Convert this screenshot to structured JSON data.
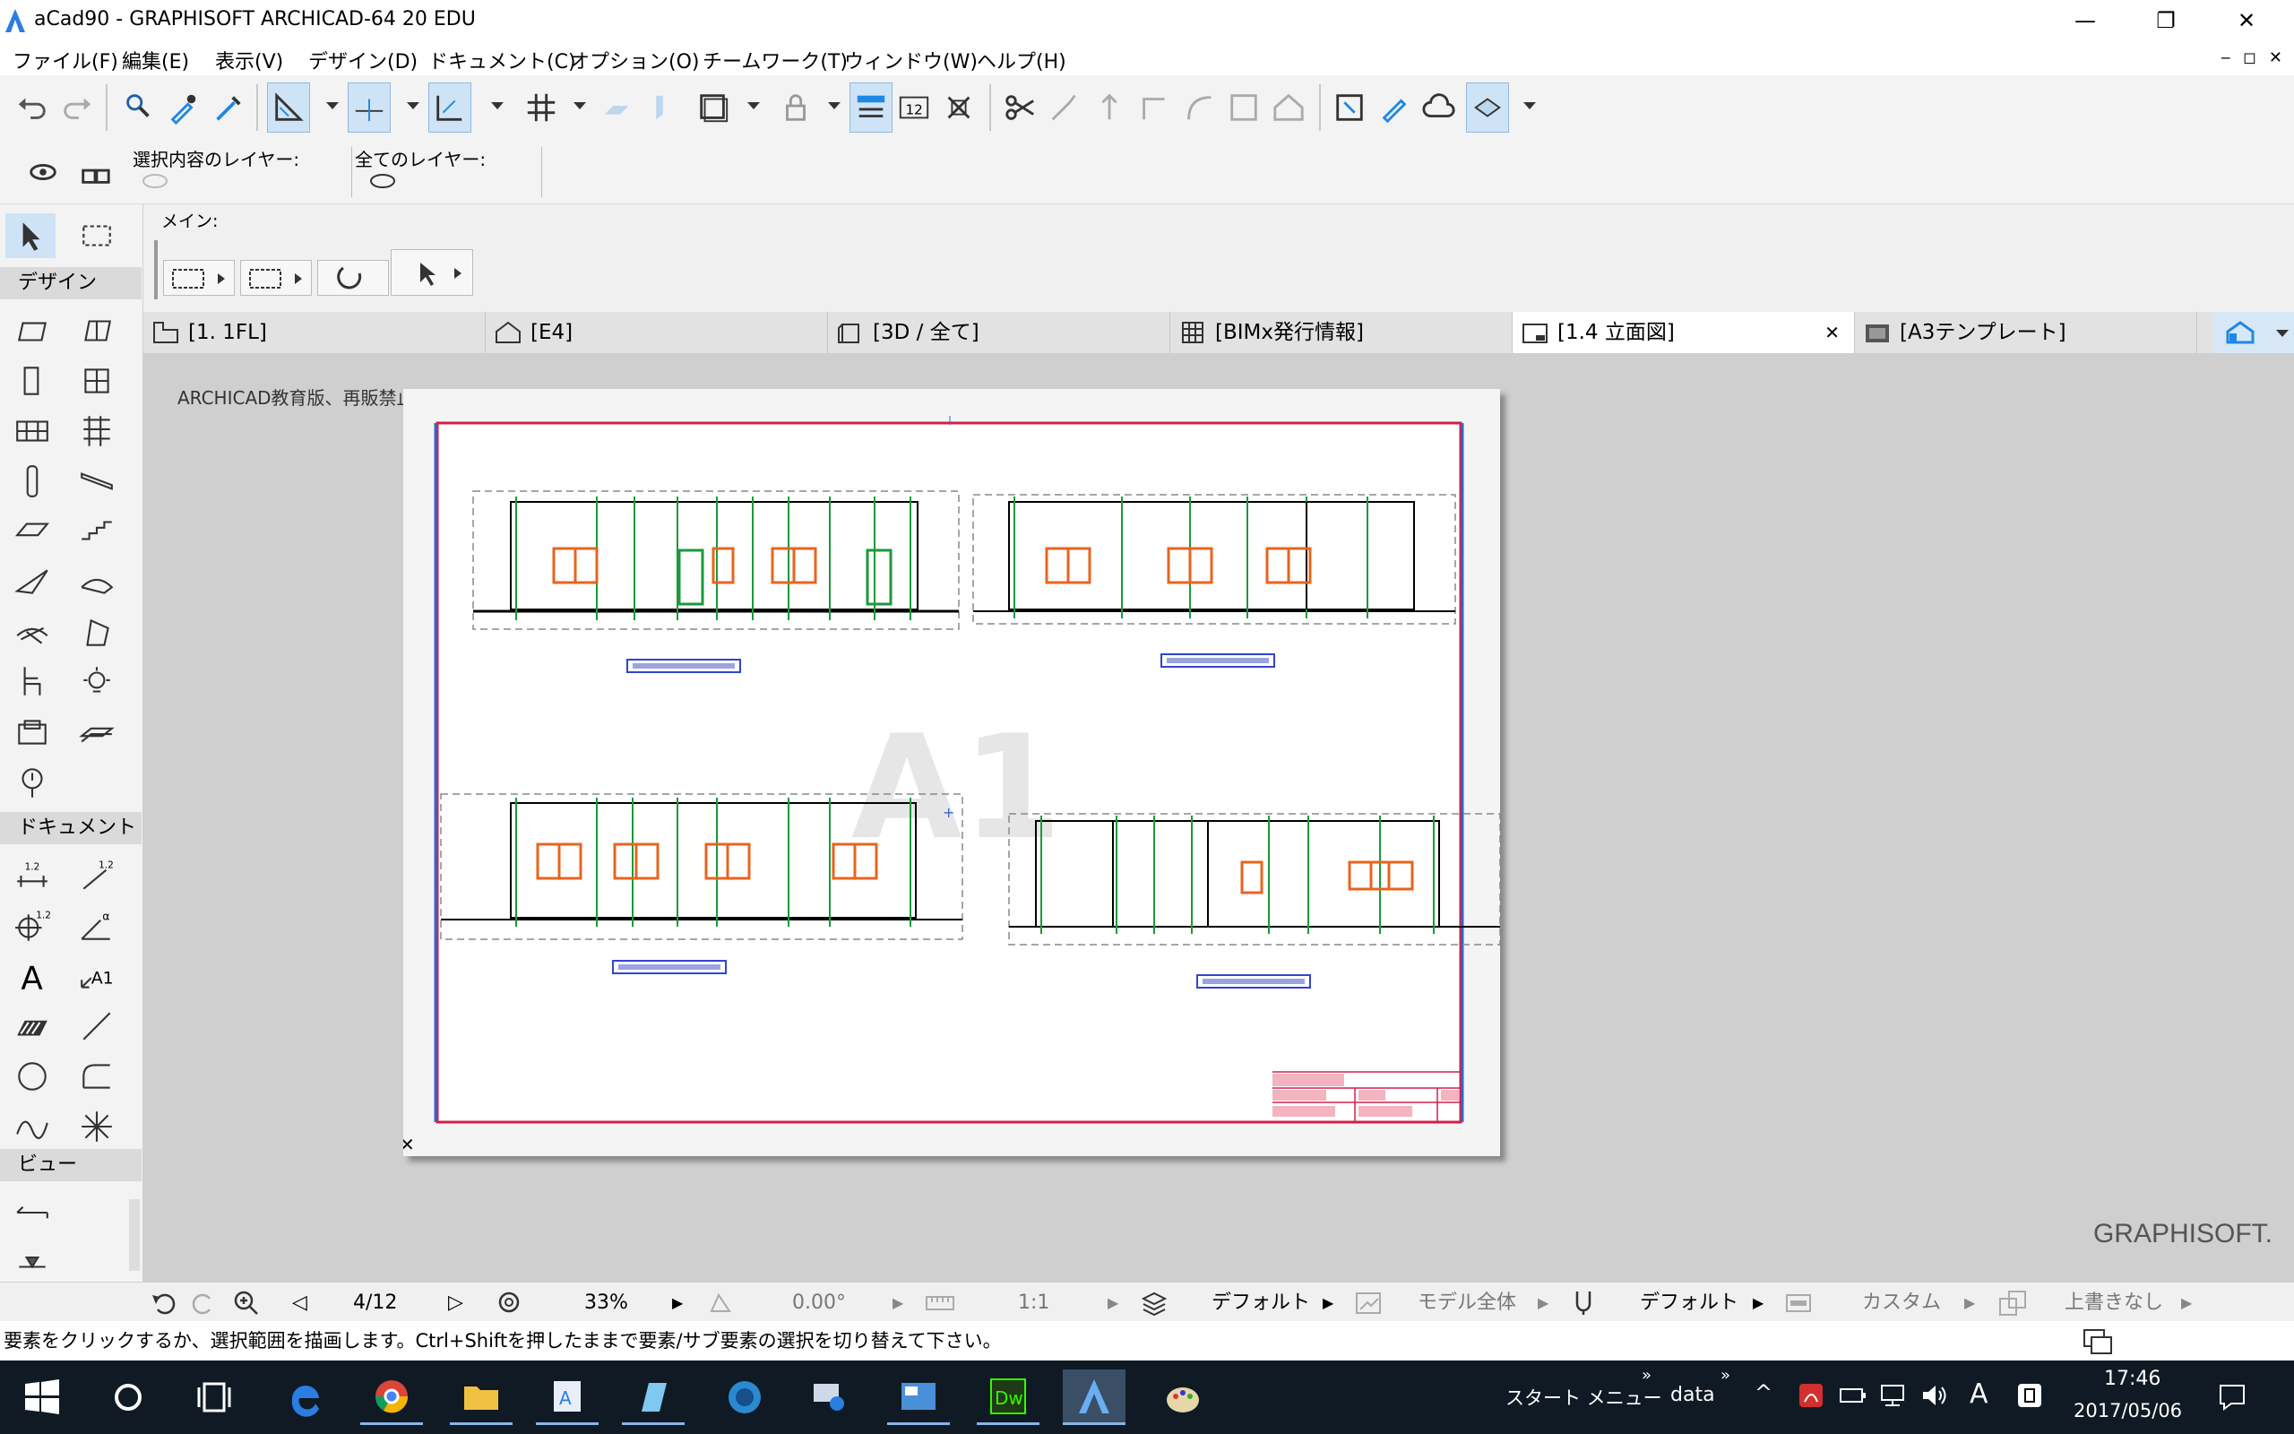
{
  "window": {
    "title": "aCad90 - GRAPHISOFT ARCHICAD-64 20 EDU",
    "minimize_glyph": "—",
    "restore_glyph": "❐",
    "close_glyph": "✕",
    "doc_controls": "‒ ◻ ✕"
  },
  "menu": [
    "ファイル(F)",
    "編集(E)",
    "表示(V)",
    "デザイン(D)",
    "ドキュメント(C)",
    "オプション(O)",
    "チームワーク(T)",
    "ウィンドウ(W)",
    "ヘルプ(H)"
  ],
  "layers": {
    "selected_label": "選択内容のレイヤー:",
    "all_label": "全てのレイヤー:"
  },
  "infobox": {
    "main_label": "メイン:"
  },
  "toolbox": {
    "design_header": "デザイン",
    "document_header": "ドキュメント",
    "view_header": "ビュー",
    "dim_label_1": "1.2",
    "dim_label_2": "1.2",
    "dim_label_3": "1.2",
    "angle_label": "α",
    "text_tool": "A",
    "label_tool": "A1"
  },
  "tabs": [
    {
      "label": "[1. 1FL]",
      "icon": "floor-plan-icon"
    },
    {
      "label": "[E4]",
      "icon": "elevation-icon"
    },
    {
      "label": "[3D / 全て]",
      "icon": "3d-icon"
    },
    {
      "label": "[BIMx発行情報]",
      "icon": "bimx-icon"
    },
    {
      "label": "[1.4 立面図]",
      "icon": "layout-icon",
      "active": true
    },
    {
      "label": "[A3テンプレート]",
      "icon": "master-layout-icon"
    }
  ],
  "tab_close": "✕",
  "canvas": {
    "notice": "ARCHICAD教育版、再販禁止。GRAPHISOFT提供。",
    "watermark": "A1",
    "brand": "GRAPHISOFT."
  },
  "status": {
    "page": "4/12",
    "zoom": "33%",
    "angle": "0.00°",
    "scale": "1:1",
    "layer_combo": "デフォルト",
    "model_view": "モデル全体",
    "pen_set": "デフォルト",
    "dim_std": "カスタム",
    "override": "上書きなし"
  },
  "hint": "要素をクリックするか、選択範囲を描画します。Ctrl+Shiftを押したままで要素/サブ要素の選択を切り替えて下さい。",
  "taskbar": {
    "start_menu": "スタート メニュー",
    "data_folder": "data",
    "chevron": "»",
    "ime": "A",
    "time": "17:46",
    "date": "2017/05/06"
  },
  "colors": {
    "accent": "#1e88e5",
    "window_red": "#e8641e",
    "door_green": "#1a9a3a",
    "sheet_border": "#d0204a",
    "taskbar": "#0f1a24"
  }
}
